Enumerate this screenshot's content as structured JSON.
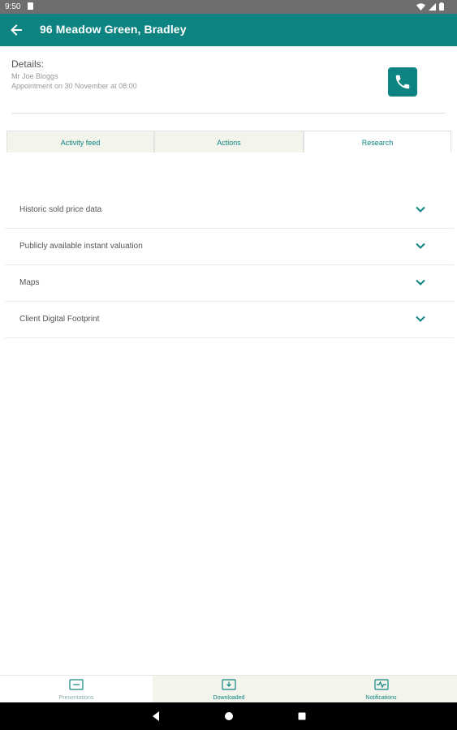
{
  "status_bar": {
    "time": "9:50"
  },
  "app_bar": {
    "title": "96 Meadow Green, Bradley"
  },
  "details": {
    "label": "Details:",
    "client": "Mr Joe Bloggs",
    "appointment": "Appointment on 30 November at 08:00"
  },
  "tabs": [
    {
      "label": "Activity feed"
    },
    {
      "label": "Actions"
    },
    {
      "label": "Research"
    }
  ],
  "active_tab": "Research",
  "research_items": [
    {
      "label": "Historic sold price data"
    },
    {
      "label": "Publicly available instant valuation"
    },
    {
      "label": "Maps"
    },
    {
      "label": "Client Digital Footprint"
    }
  ],
  "bottom_nav": [
    {
      "label": "Presentations",
      "icon": "presentation-icon"
    },
    {
      "label": "Downloaded",
      "icon": "download-icon"
    },
    {
      "label": "Notifications",
      "icon": "activity-icon"
    }
  ],
  "colors": {
    "primary": "#0d8481",
    "tab_bg": "#f3f5ec"
  }
}
